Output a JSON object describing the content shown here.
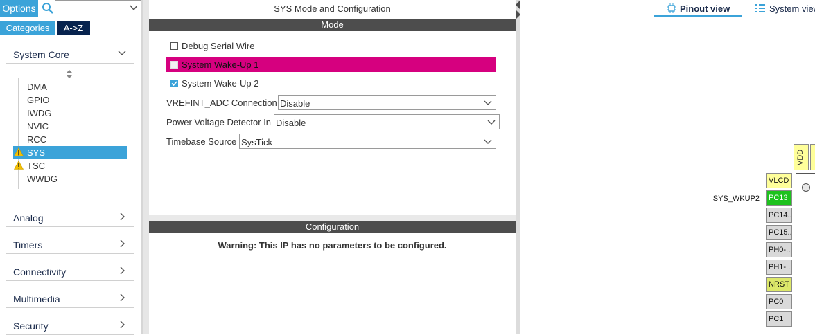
{
  "left": {
    "options_label": "Options",
    "search_placeholder": "",
    "categories_label": "Categories",
    "az_label": "A->Z",
    "groups": {
      "system_core": "System Core",
      "analog": "Analog",
      "timers": "Timers",
      "connectivity": "Connectivity",
      "multimedia": "Multimedia",
      "security": "Security"
    },
    "peripherals": [
      "DMA",
      "GPIO",
      "IWDG",
      "NVIC",
      "RCC",
      "SYS",
      "TSC",
      "WWDG"
    ],
    "selected_peripheral": "SYS",
    "warning_peripherals": [
      "SYS",
      "TSC"
    ]
  },
  "center": {
    "title": "SYS Mode and Configuration",
    "mode_header": "Mode",
    "checkboxes": [
      {
        "label": "Debug Serial Wire",
        "checked": false,
        "highlighted": false
      },
      {
        "label": "System Wake-Up 1",
        "checked": false,
        "highlighted": true
      },
      {
        "label": "System Wake-Up 2",
        "checked": true,
        "highlighted": false
      }
    ],
    "fields": [
      {
        "label": "VREFINT_ADC Connection",
        "value": "Disable"
      },
      {
        "label": "Power Voltage Detector In",
        "value": "Disable"
      },
      {
        "label": "Timebase Source",
        "value": "SysTick"
      }
    ],
    "config_header": "Configuration",
    "config_warning": "Warning: This IP has no parameters to be configured."
  },
  "right": {
    "tab_pinout": "Pinout view",
    "tab_system": "System view",
    "signal_label": "SYS_WKUP2",
    "top_pin": "VDD",
    "pins": [
      {
        "label": "VLCD",
        "color": "yellow"
      },
      {
        "label": "PC13",
        "color": "green"
      },
      {
        "label": "PC14..",
        "color": "gray"
      },
      {
        "label": "PC15..",
        "color": "gray"
      },
      {
        "label": "PH0-..",
        "color": "gray"
      },
      {
        "label": "PH1-..",
        "color": "gray"
      },
      {
        "label": "NRST",
        "color": "olive"
      },
      {
        "label": "PC0",
        "color": "gray"
      },
      {
        "label": "PC1",
        "color": "gray"
      }
    ]
  },
  "colors": {
    "accent": "#3ba3d9",
    "dark_navy": "#07234e",
    "highlight_pink": "#d6007f",
    "bar_gray": "#4d4d4d",
    "pin_green": "#1ec21e",
    "pin_yellow": "#ffff9a",
    "pin_olive": "#dde86a",
    "warning": "#f5c000"
  }
}
